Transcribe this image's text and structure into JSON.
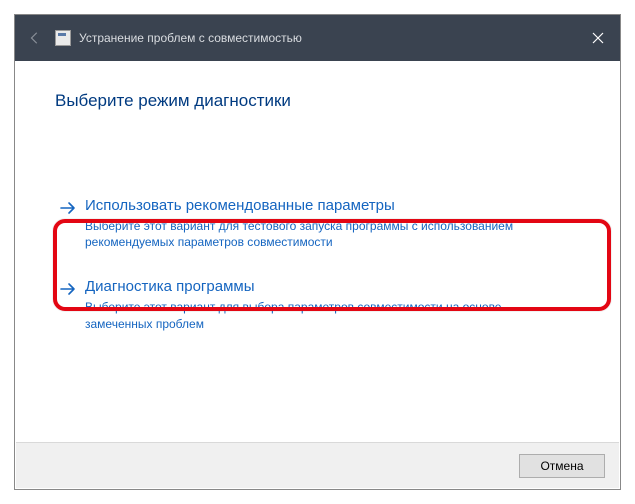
{
  "titlebar": {
    "title": "Устранение проблем с совместимостью"
  },
  "content": {
    "heading": "Выберите режим диагностики",
    "options": [
      {
        "title": "Использовать рекомендованные параметры",
        "description": "Выберите этот вариант для тестового запуска программы с использованием рекомендуемых параметров совместимости"
      },
      {
        "title": "Диагностика программы",
        "description": "Выберите этот вариант для выбора параметров совместимости на основе замеченных проблем"
      }
    ]
  },
  "footer": {
    "cancel_label": "Отмена"
  }
}
